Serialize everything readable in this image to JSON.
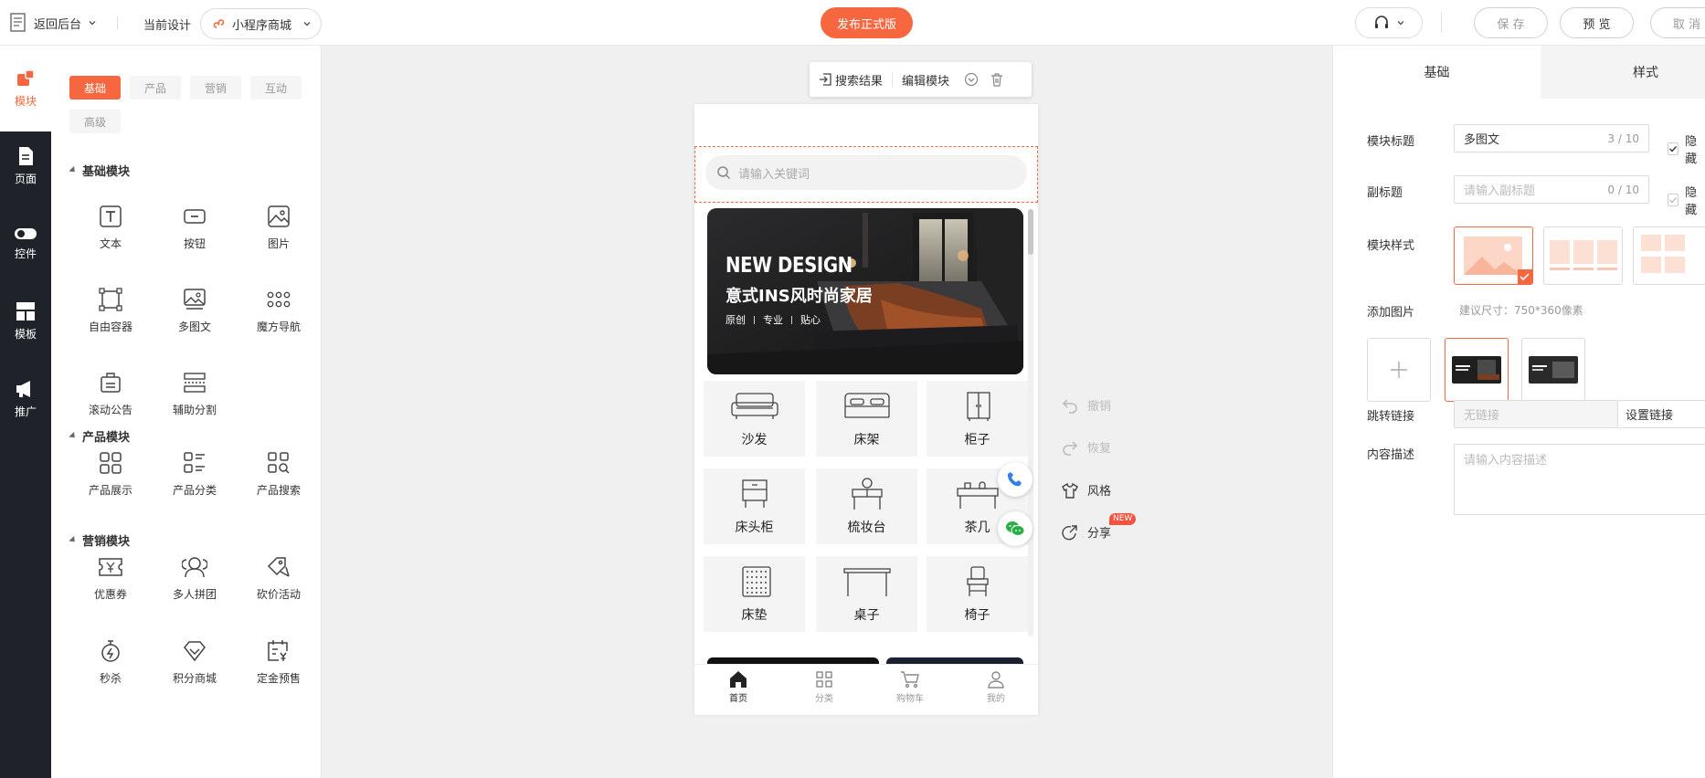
{
  "topbar": {
    "back_label": "返回后台",
    "current_design_label": "当前设计",
    "app_select_value": "小程序商城",
    "publish_label": "发布正式版",
    "save_label": "保 存",
    "preview_label": "预 览",
    "cancel_label": "取 消"
  },
  "sidebar": {
    "items": [
      {
        "label": "模块",
        "icon": "module-icon"
      },
      {
        "label": "页面",
        "icon": "page-icon"
      },
      {
        "label": "控件",
        "icon": "toggle-icon"
      },
      {
        "label": "模板",
        "icon": "template-icon"
      },
      {
        "label": "推广",
        "icon": "megaphone-icon"
      }
    ]
  },
  "palette": {
    "tabs": [
      "基础",
      "产品",
      "营销",
      "互动",
      "高级"
    ],
    "sections": [
      {
        "title": "基础模块",
        "items": [
          "文本",
          "按钮",
          "图片",
          "自由容器",
          "多图文",
          "魔方导航",
          "滚动公告",
          "辅助分割"
        ]
      },
      {
        "title": "产品模块",
        "items": [
          "产品展示",
          "产品分类",
          "产品搜索"
        ]
      },
      {
        "title": "营销模块",
        "items": [
          "优惠券",
          "多人拼团",
          "砍价活动",
          "秒杀",
          "积分商城",
          "定金预售"
        ]
      }
    ]
  },
  "canvas": {
    "toolbar": {
      "search_result_label": "搜索结果",
      "edit_module_label": "编辑模块"
    },
    "search_placeholder": "请输入关键词",
    "banner": {
      "title": "NEW DESIGN",
      "subtitle": "意式INS风时尚家居",
      "tags": [
        "原创",
        "专业",
        "贴心"
      ]
    },
    "categories": [
      "沙发",
      "床架",
      "柜子",
      "床头柜",
      "梳妆台",
      "茶几",
      "床垫",
      "桌子",
      "椅子"
    ],
    "tabbar": [
      "首页",
      "分类",
      "购物车",
      "我的"
    ],
    "side_actions": {
      "undo": "撤销",
      "redo": "恢复",
      "style": "风格",
      "share": "分享",
      "new_badge": "NEW"
    }
  },
  "rpanel": {
    "tabs": [
      "基础",
      "样式"
    ],
    "module_title": {
      "label": "模块标题",
      "value": "多图文",
      "count": "3 / 10",
      "hide": "隐藏"
    },
    "subtitle": {
      "label": "副标题",
      "placeholder": "请输入副标题",
      "count": "0 / 10",
      "hide": "隐藏"
    },
    "module_style_label": "模块样式",
    "add_image": {
      "label": "添加图片",
      "hint": "建议尺寸：750*360像素"
    },
    "link": {
      "label": "跳转链接",
      "placeholder": "无链接",
      "button": "设置链接"
    },
    "desc": {
      "label": "内容描述",
      "placeholder": "请输入内容描述"
    }
  },
  "colors": {
    "accent": "#f6673f",
    "dark_sidebar": "#1f2329"
  }
}
